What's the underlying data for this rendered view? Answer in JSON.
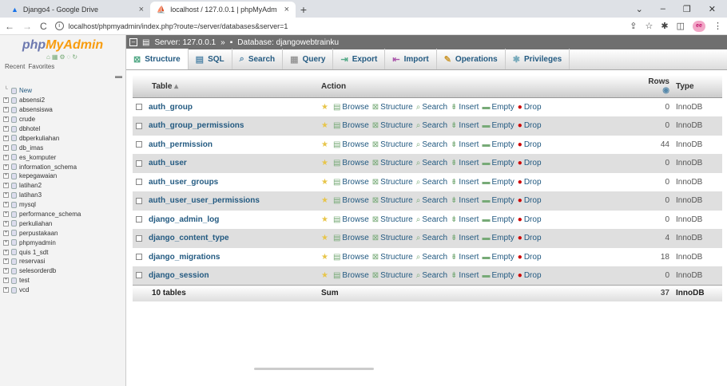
{
  "browser": {
    "tabs": [
      {
        "title": "Django4 - Google Drive"
      },
      {
        "title": "localhost / 127.0.0.1 | phpMyAdm"
      }
    ],
    "url": "localhost/phpmyadmin/index.php?route=/server/databases&server=1"
  },
  "sidebar": {
    "logo_a": "php",
    "logo_b": "MyAdmin",
    "tab_recent": "Recent",
    "tab_favorites": "Favorites",
    "new_label": "New",
    "databases": [
      "absensi2",
      "absensiswa",
      "crude",
      "dbhotel",
      "dbperkuliahan",
      "db_imas",
      "es_komputer",
      "information_schema",
      "kepegawaian",
      "latihan2",
      "latihan3",
      "mysql",
      "performance_schema",
      "perkuliahan",
      "perpustakaan",
      "phpmyadmin",
      "quis 1_sdt",
      "reservasi",
      "selesorderdb",
      "test",
      "vcd"
    ]
  },
  "breadcrumb": {
    "server": "Server: 127.0.0.1",
    "database": "Database: djangowebtrainku"
  },
  "menu": [
    "Structure",
    "SQL",
    "Search",
    "Query",
    "Export",
    "Import",
    "Operations",
    "Privileges"
  ],
  "table": {
    "headers": {
      "table": "Table",
      "action": "Action",
      "rows": "Rows",
      "type": "Type"
    },
    "actions": [
      "Browse",
      "Structure",
      "Search",
      "Insert",
      "Empty",
      "Drop"
    ],
    "rows": [
      {
        "name": "auth_group",
        "rows": "0",
        "type": "InnoDB"
      },
      {
        "name": "auth_group_permissions",
        "rows": "0",
        "type": "InnoDB"
      },
      {
        "name": "auth_permission",
        "rows": "44",
        "type": "InnoDB"
      },
      {
        "name": "auth_user",
        "rows": "0",
        "type": "InnoDB"
      },
      {
        "name": "auth_user_groups",
        "rows": "0",
        "type": "InnoDB"
      },
      {
        "name": "auth_user_user_permissions",
        "rows": "0",
        "type": "InnoDB"
      },
      {
        "name": "django_admin_log",
        "rows": "0",
        "type": "InnoDB"
      },
      {
        "name": "django_content_type",
        "rows": "4",
        "type": "InnoDB"
      },
      {
        "name": "django_migrations",
        "rows": "18",
        "type": "InnoDB"
      },
      {
        "name": "django_session",
        "rows": "0",
        "type": "InnoDB"
      }
    ],
    "footer": {
      "count": "10 tables",
      "sum": "Sum",
      "rows": "37",
      "type": "InnoDB"
    }
  }
}
